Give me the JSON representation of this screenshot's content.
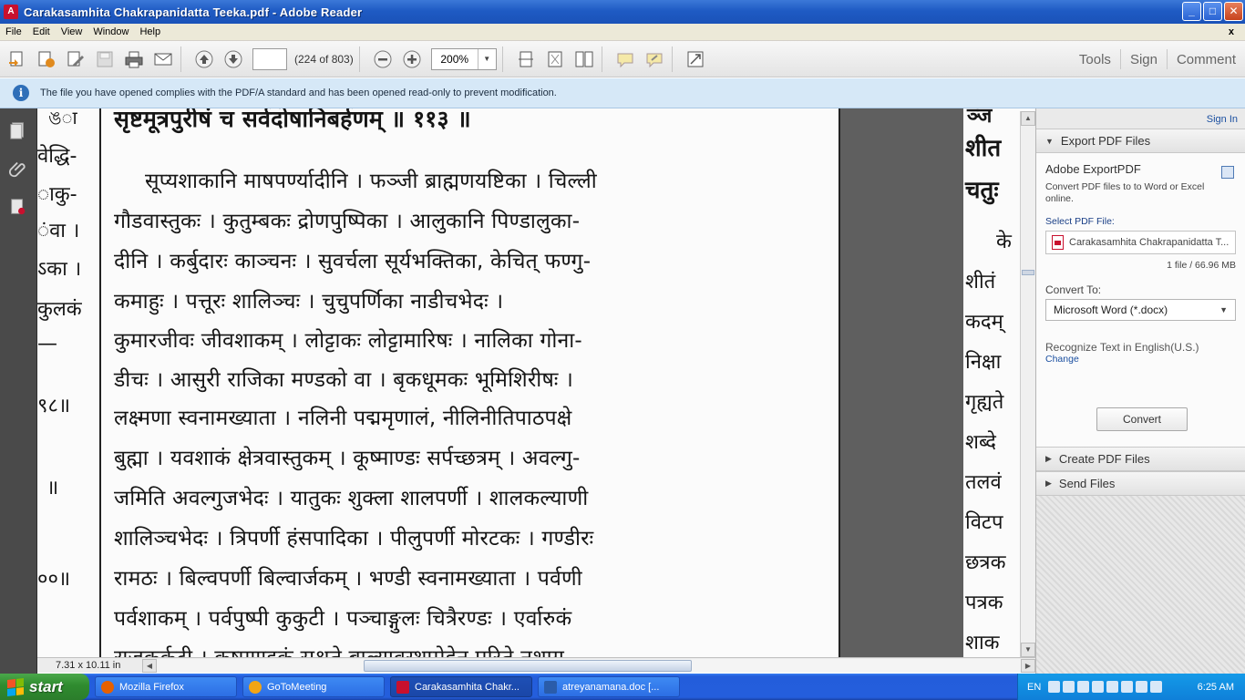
{
  "window": {
    "title": "Carakasamhita Chakrapanidatta Teeka.pdf - Adobe Reader",
    "app_icon": "adobe-reader-icon",
    "controls": {
      "minimize": "_",
      "maximize": "□",
      "close": "✕"
    }
  },
  "menu": {
    "items": [
      "File",
      "Edit",
      "View",
      "Window",
      "Help"
    ],
    "close_glyph": "x"
  },
  "toolbar": {
    "page_input_value": "",
    "page_count": "(224 of 803)",
    "zoom_value": "200%",
    "right_links": [
      "Tools",
      "Sign",
      "Comment"
    ]
  },
  "infobar": {
    "message": "The file you have opened complies with the PDF/A standard and has been opened read-only to prevent modification."
  },
  "document": {
    "left_margin_lines": [
      "ঙा",
      "वेद्धि-",
      "ाकु-",
      "ंवा ।",
      "ऽका ।",
      "कुलकं",
      "—",
      "९८॥",
      "॥",
      "००॥"
    ],
    "heading_line": "सृष्टमूत्रपुरीषं च सर्वदोषानिबर्हणम् ॥ ११३ ॥",
    "body_lines": [
      "सूप्यशाकानि माषपर्ण्यादीनि । फञ्जी ब्राह्मणयष्टिका । चिल्ली",
      "गौडवास्तुकः । कुतुम्बकः द्रोणपुष्पिका । आलुकानि पिण्डालुका-",
      "दीनि । कर्बुदारः काञ्चनः । सुवर्चला सूर्यभक्तिका, केचित् फण्गु-",
      "कमाहुः । पत्तूरः शालिञ्चः । चुचुपर्णिका नाडीचभेदः ।",
      "कुमारजीवः जीवशाकम् । लोट्टाकः लोट्टामारिषः । नालिका गोना-",
      "डीचः । आसुरी राजिका मण्डको वा । बृकधूमकः भूमिशिरीषः ।",
      "लक्ष्मणा स्वनामख्याता । नलिनी पद्ममृणालं, नीलिनीतिपाठपक्षे",
      "बुह्मा । यवशाकं क्षेत्रवास्तुकम् । कूष्माण्डः सर्पच्छत्रम् । अवल्गु-",
      "जमिति अवल्गुजभेदः । यातुकः शुक्ला शालपर्णी । शालकल्याणी",
      "शालिञ्चभेदः । त्रिपर्णी हंसपादिका । पीलुपर्णी मोरटकः । गण्डीरः",
      "रामठः । बिल्वपर्णी बिल्वार्जकम् । भण्डी स्वनामख्याता । पर्वणी",
      "पर्वशाकम् । पर्वपुष्पी कुकुटी । पञ्चाङ्गुलः चित्रैरण्डः । एर्वारुकं",
      "राजकर्कटी । कूष्माण्डकं सश्रुते बाल्यावस्थामेहेन परिते नशाग"
    ],
    "right_page_lines": [
      "ञ्ज",
      "शीत",
      "चतुः",
      "के",
      "शीतं",
      "कदम्",
      "निक्षा",
      "गृह्यते",
      "शब्दे",
      "तलवं",
      "विटप",
      "छत्रक",
      "पत्रक",
      "शाक"
    ]
  },
  "statusbar": {
    "page_size": "7.31 x 10.11 in"
  },
  "tools_panel": {
    "sign_in": "Sign In",
    "export": {
      "section_title": "Export PDF Files",
      "heading": "Adobe ExportPDF",
      "description": "Convert PDF files to to Word or Excel online.",
      "select_label": "Select PDF File:",
      "file_name": "Carakasamhita Chakrapanidatta T...",
      "file_count": "1 file / 66.96 MB",
      "convert_to_label": "Convert To:",
      "convert_to_value": "Microsoft Word (*.docx)",
      "recognize_text": "Recognize Text in English(U.S.)",
      "change_link": "Change",
      "convert_button": "Convert"
    },
    "create_section": "Create PDF Files",
    "send_section": "Send Files"
  },
  "taskbar": {
    "start_label": "start",
    "tasks": [
      {
        "label": "Mozilla Firefox",
        "color": "#e66000"
      },
      {
        "label": "GoToMeeting",
        "color": "#f2a516"
      },
      {
        "label": "Carakasamhita Chakr...",
        "color": "#c8102e"
      },
      {
        "label": "atreyanamana.doc [...",
        "color": "#2a5caa"
      }
    ],
    "tray": {
      "language": "EN",
      "clock": "6:25 AM"
    }
  }
}
